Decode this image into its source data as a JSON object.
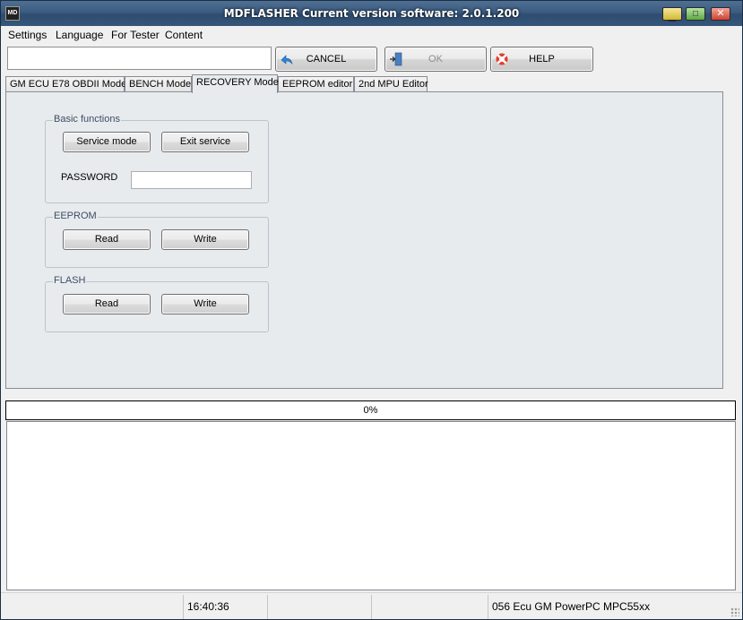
{
  "window": {
    "title": "MDFLASHER  Current version software: 2.0.1.200",
    "app_icon": "MD"
  },
  "menu": [
    {
      "label": "Settings"
    },
    {
      "label": "Language"
    },
    {
      "label": "For Tester"
    },
    {
      "label": "Content"
    }
  ],
  "toolbar": {
    "input_value": "",
    "cancel_label": "CANCEL",
    "ok_label": "OK",
    "help_label": "HELP",
    "cancel_icon": "back-arrow-icon",
    "ok_icon": "door-exit-icon",
    "help_icon": "lifebuoy-icon"
  },
  "tabs": [
    {
      "label": "GM ECU E78 OBDII Mode",
      "active": false
    },
    {
      "label": "BENCH Mode",
      "active": false
    },
    {
      "label": "RECOVERY Mode",
      "active": true
    },
    {
      "label": "EEPROM editor",
      "active": false
    },
    {
      "label": "2nd MPU Editor",
      "active": false
    }
  ],
  "recovery": {
    "basic": {
      "title": "Basic functions",
      "service_mode": "Service mode",
      "exit_service": "Exit service",
      "password_label": "PASSWORD",
      "password_value": ""
    },
    "eeprom": {
      "title": "EEPROM",
      "read": "Read",
      "write": "Write"
    },
    "flash": {
      "title": "FLASH",
      "read": "Read",
      "write": "Write"
    }
  },
  "progress": {
    "value": 0,
    "text": "0%"
  },
  "status": {
    "time": "16:40:36",
    "ecu": "056 Ecu GM PowerPC MPC55xx"
  },
  "colors": {
    "titlebar": "#3b5b80",
    "panel": "#e8ebee",
    "progress_fill": "#3399ff"
  }
}
